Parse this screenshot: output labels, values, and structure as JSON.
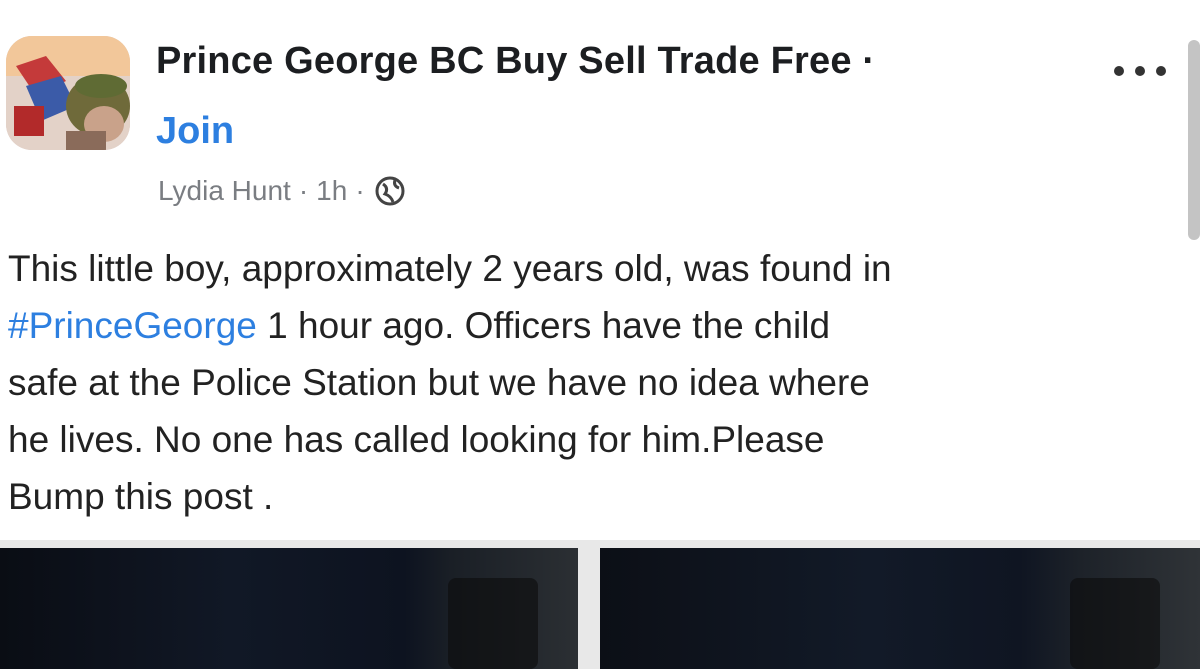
{
  "post": {
    "group_name": "Prince George BC Buy Sell Trade Free ·",
    "join_label": "Join",
    "author": "Lydia Hunt",
    "separator": "·",
    "time": "1h",
    "privacy_icon": "globe-icon",
    "more_icon": "more-options-icon",
    "text_line1": "This little boy, approximately 2 years old, was found in",
    "hashtag": "#PrinceGeorge",
    "text_line2_rest": " 1 hour ago. Officers have the child",
    "text_line3": "safe at the Police Station but we have no idea where",
    "text_line4": "he lives. No one has called looking for him.Please",
    "text_line5": "Bump this post ."
  },
  "colors": {
    "link": "#2d7fe0",
    "text": "#222222",
    "meta": "#7a7d82"
  }
}
